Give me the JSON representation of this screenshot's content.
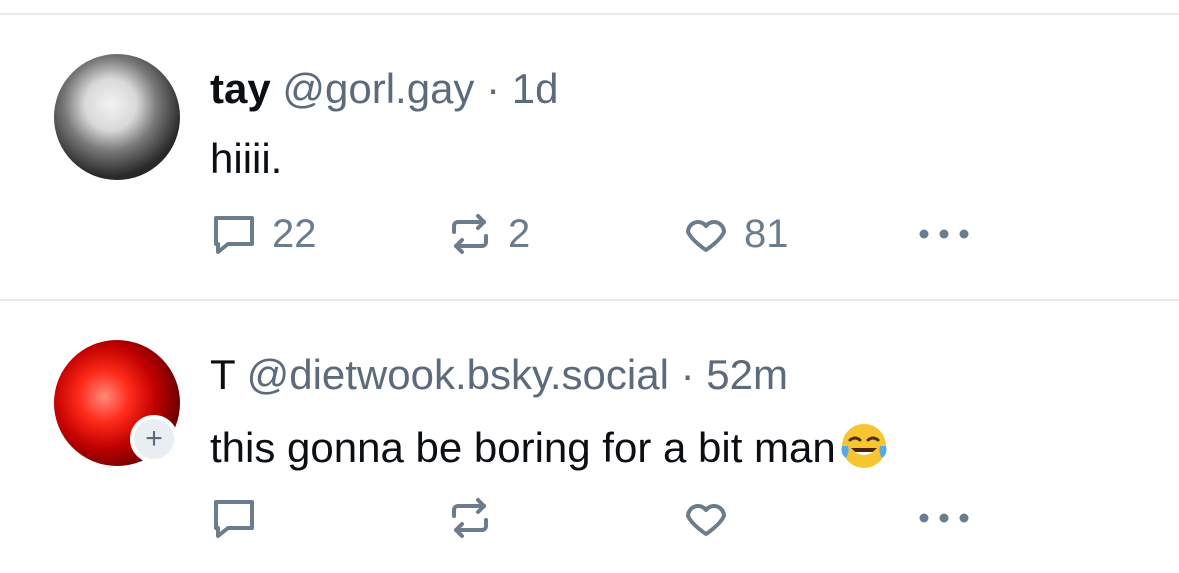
{
  "posts": [
    {
      "display_name": "tay",
      "handle": "@gorl.gay",
      "separator": "·",
      "time": "1d",
      "text": "hiiii.",
      "actions": {
        "reply_count": "22",
        "repost_count": "2",
        "like_count": "81"
      }
    },
    {
      "display_name": "T",
      "handle": "@dietwook.bsky.social",
      "separator": "·",
      "time": "52m",
      "text": "this gonna be boring for a bit man",
      "emoji": "face-with-tears-of-joy",
      "follow_badge": "+",
      "actions": {
        "reply_count": "",
        "repost_count": "",
        "like_count": ""
      }
    }
  ],
  "icons": {
    "reply": "reply-icon",
    "repost": "repost-icon",
    "like": "like-icon",
    "more": "more-options-icon"
  },
  "colors": {
    "text_primary": "#0b0f14",
    "text_secondary": "#5b6b7c",
    "icon": "#6b7c8d",
    "divider": "#e6e9ed"
  }
}
